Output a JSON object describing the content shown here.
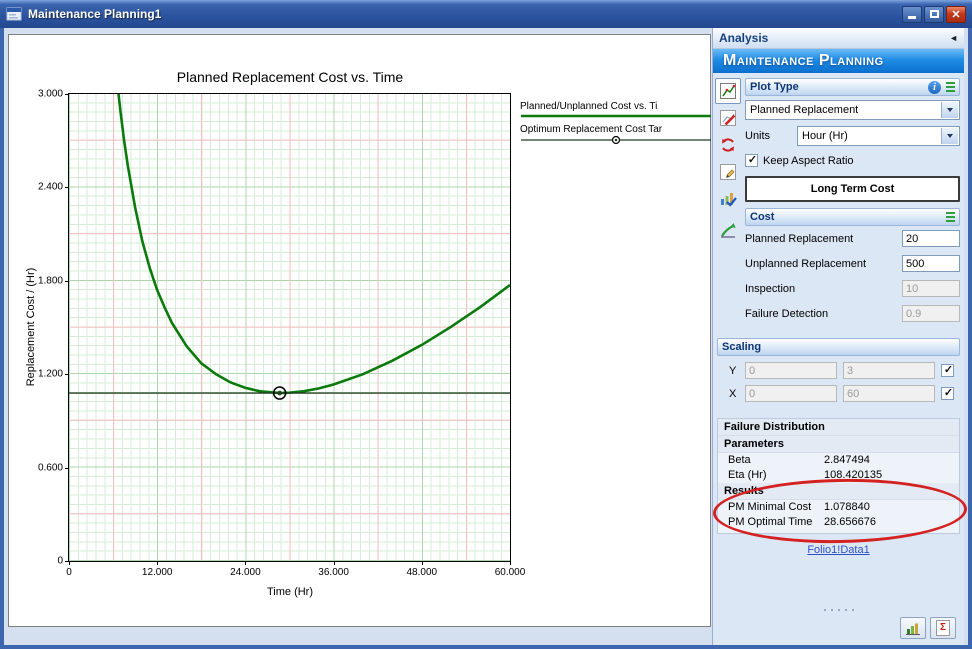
{
  "window": {
    "title": "Maintenance Planning1"
  },
  "icons": {
    "collapse_arrow": "◄",
    "close": "✕",
    "info": "i",
    "report_sigma": "Σ"
  },
  "chart_data": {
    "type": "line",
    "title": "Planned Replacement Cost vs. Time",
    "xlabel": "Time (Hr)",
    "ylabel": "Replacement Cost / (Hr)",
    "xlim": [
      0,
      60
    ],
    "ylim": [
      0,
      3
    ],
    "x_ticks": [
      0,
      12,
      24,
      36,
      48,
      60
    ],
    "x_tick_labels": [
      "0",
      "12.000",
      "24.000",
      "36.000",
      "48.000",
      "60.000"
    ],
    "y_ticks": [
      0,
      0.6,
      1.2,
      1.8,
      2.4,
      3
    ],
    "y_tick_labels": [
      "0",
      "0.600",
      "1.200",
      "1.800",
      "2.400",
      "3.000"
    ],
    "grid": {
      "fine_color": "#d7ecd7",
      "major_color": "#aed7ae",
      "accent_color": "#f2bdbd",
      "grid_on": true
    },
    "legend_position": "top-right",
    "series": [
      {
        "name": "Planned/Unplanned Cost vs. Ti",
        "type": "line",
        "color": "#0a7a0a",
        "x": [
          6.2,
          6.5,
          7,
          7.5,
          8,
          9,
          10,
          11,
          12,
          13,
          14,
          16,
          18,
          20,
          22,
          24,
          26,
          28.657,
          30,
          32,
          34,
          36,
          40,
          44,
          48,
          52,
          56,
          60
        ],
        "y": [
          3.25,
          3.1,
          2.89,
          2.7,
          2.54,
          2.27,
          2.05,
          1.88,
          1.74,
          1.63,
          1.53,
          1.38,
          1.27,
          1.2,
          1.147,
          1.112,
          1.09,
          1.0788,
          1.081,
          1.091,
          1.109,
          1.134,
          1.2,
          1.287,
          1.388,
          1.505,
          1.633,
          1.773
        ]
      },
      {
        "name": "Optimum Replacement Cost Tar",
        "type": "target-line",
        "color": "#223f22",
        "y_value": 1.07884,
        "marker_x": 28.656676
      }
    ]
  },
  "panel": {
    "analysis_title": "Analysis",
    "banner": "Maintenance Planning",
    "plot_type": {
      "title": "Plot Type",
      "plot_dropdown_value": "Planned Replacement",
      "units_label": "Units",
      "units_dropdown_value": "Hour (Hr)",
      "keep_aspect_label": "Keep Aspect Ratio",
      "keep_aspect_checked": true,
      "long_term_button": "Long Term Cost"
    },
    "cost": {
      "title": "Cost",
      "rows": [
        {
          "label": "Planned Replacement",
          "value": "20",
          "enabled": true
        },
        {
          "label": "Unplanned Replacement",
          "value": "500",
          "enabled": true
        },
        {
          "label": "Inspection",
          "value": "10",
          "enabled": false
        },
        {
          "label": "Failure Detection",
          "value": "0.9",
          "enabled": false
        }
      ]
    },
    "scaling": {
      "title": "Scaling",
      "rows": [
        {
          "axis": "Y",
          "min": "0",
          "max": "3",
          "auto": true
        },
        {
          "axis": "X",
          "min": "0",
          "max": "60",
          "auto": true
        }
      ]
    },
    "failure_distribution": {
      "title": "Failure Distribution",
      "parameters_title": "Parameters",
      "parameters": [
        {
          "label": "Beta",
          "value": "2.847494"
        },
        {
          "label": "Eta (Hr)",
          "value": "108.420135"
        }
      ],
      "results_title": "Results",
      "results": [
        {
          "label": "PM Minimal Cost",
          "value": "1.078840"
        },
        {
          "label": "PM Optimal Time",
          "value": "28.656676"
        }
      ],
      "data_link": "Folio1!Data1"
    }
  },
  "colors": {
    "titlebar_blue": "#2b539d",
    "banner_blue": "#1f8ce4",
    "curve_green": "#0a7a0a",
    "optimum_line_green": "#223f22",
    "highlight_red": "#d42222",
    "link_blue": "#2d50c7"
  }
}
